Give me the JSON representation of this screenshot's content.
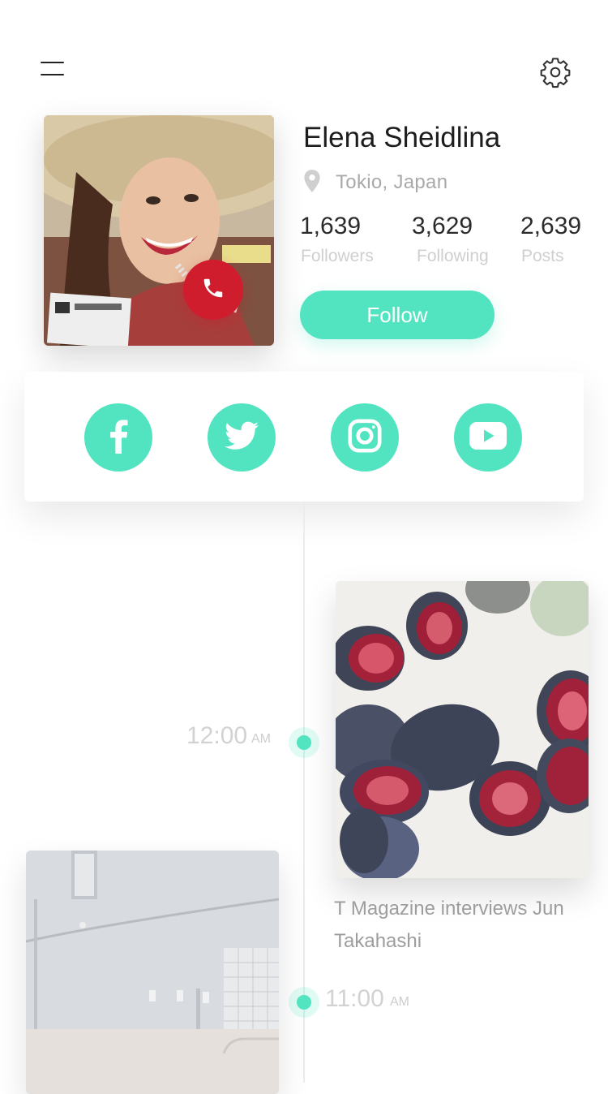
{
  "header": {
    "menu_icon": "hamburger-menu-icon",
    "settings_icon": "gear-icon"
  },
  "profile": {
    "name": "Elena Sheidlina",
    "location": "Tokio, Japan",
    "location_icon": "map-pin-icon",
    "call_icon": "phone-icon",
    "stats": [
      {
        "value": "1,639",
        "label": "Followers"
      },
      {
        "value": "3,629",
        "label": "Following"
      },
      {
        "value": "2,639",
        "label": "Posts"
      }
    ],
    "follow_label": "Follow"
  },
  "social": {
    "items": [
      {
        "name": "facebook",
        "icon": "facebook-icon"
      },
      {
        "name": "twitter",
        "icon": "twitter-icon"
      },
      {
        "name": "instagram",
        "icon": "instagram-icon"
      },
      {
        "name": "youtube",
        "icon": "youtube-icon"
      }
    ]
  },
  "timeline": {
    "entries": [
      {
        "time": "12:00",
        "ampm": "AM",
        "caption": "T Magazine interviews Jun Takahashi"
      },
      {
        "time": "11:00",
        "ampm": "AM"
      }
    ]
  },
  "colors": {
    "accent": "#52e4c0",
    "call": "#cf1d2e",
    "muted_text": "#a9a9a9"
  }
}
